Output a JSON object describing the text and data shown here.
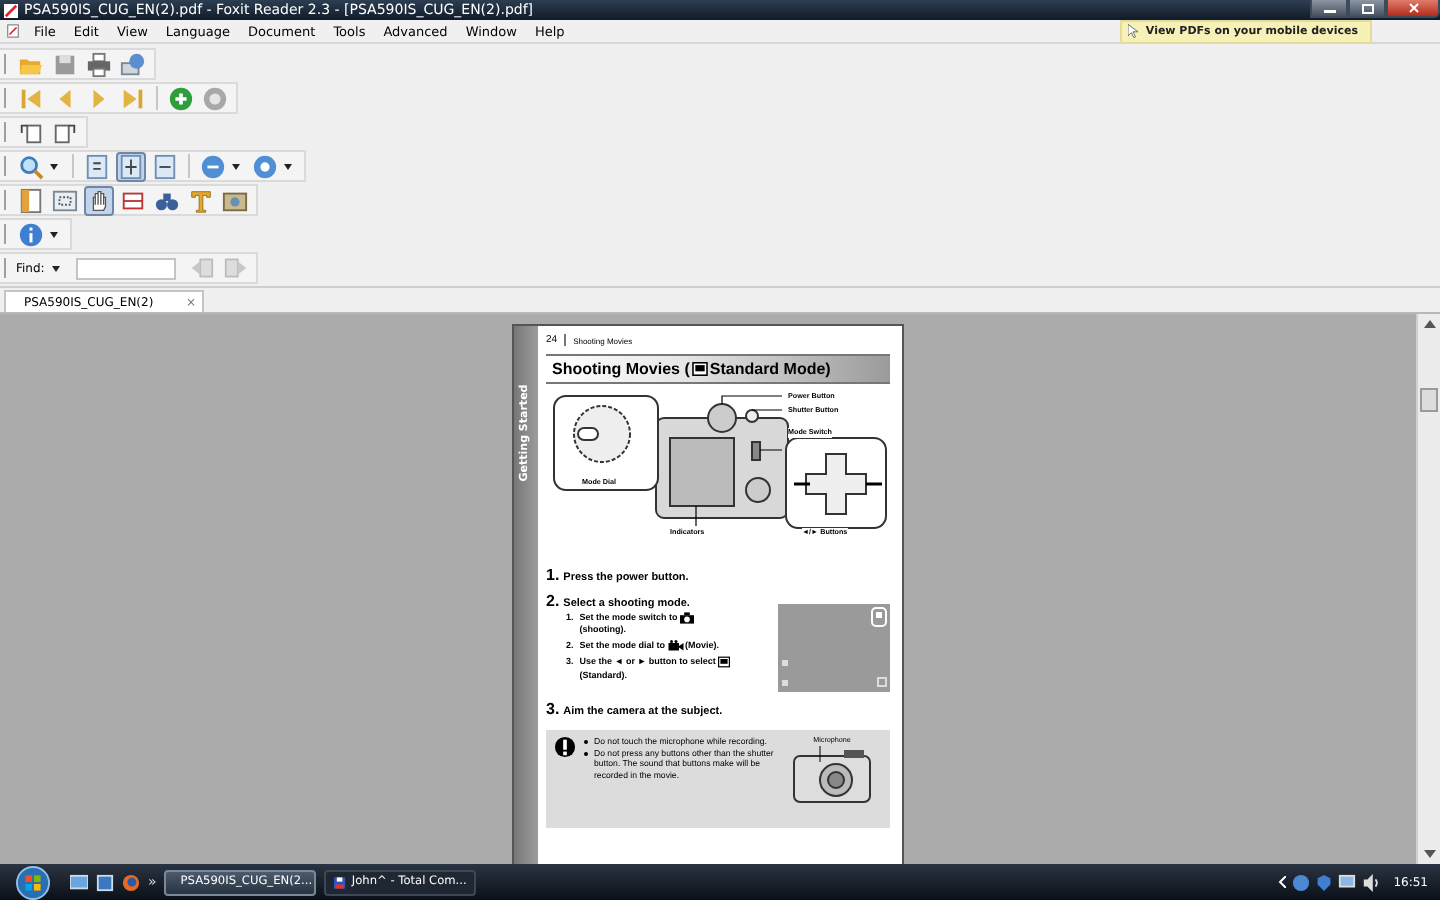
{
  "window": {
    "title": "PSA590IS_CUG_EN(2).pdf - Foxit Reader 2.3 - [PSA590IS_CUG_EN(2).pdf]"
  },
  "menu": [
    "File",
    "Edit",
    "View",
    "Language",
    "Document",
    "Tools",
    "Advanced",
    "Window",
    "Help"
  ],
  "promo": "View PDFs on your mobile devices",
  "toolbars": [
    {
      "tools": [
        {
          "kind": "open",
          "selected": false
        },
        {
          "kind": "save",
          "selected": false
        },
        {
          "kind": "print",
          "selected": false
        },
        {
          "kind": "globe",
          "selected": false
        }
      ]
    },
    {
      "tools": [
        {
          "kind": "first",
          "selected": false
        },
        {
          "kind": "prev",
          "selected": false
        },
        {
          "kind": "next",
          "selected": false
        },
        {
          "kind": "last",
          "selected": false
        },
        {
          "kind": "sep"
        },
        {
          "kind": "forward",
          "selected": false
        },
        {
          "kind": "back",
          "selected": false
        }
      ]
    },
    {
      "tools": [
        {
          "kind": "rotate-left",
          "selected": false
        },
        {
          "kind": "rotate-right",
          "selected": false
        }
      ]
    },
    {
      "tools": [
        {
          "kind": "zoom",
          "selected": false,
          "dropdown": true
        },
        {
          "kind": "sep"
        },
        {
          "kind": "actual",
          "selected": false
        },
        {
          "kind": "fit-page",
          "selected": true
        },
        {
          "kind": "fit-width",
          "selected": false
        },
        {
          "kind": "sep"
        },
        {
          "kind": "zoom-out",
          "selected": false,
          "dropdown": true
        },
        {
          "kind": "zoom-in",
          "selected": false,
          "dropdown": true
        }
      ]
    },
    {
      "tools": [
        {
          "kind": "page",
          "selected": false
        },
        {
          "kind": "snapshot",
          "selected": false
        },
        {
          "kind": "hand",
          "selected": true
        },
        {
          "kind": "select",
          "selected": false
        },
        {
          "kind": "binoculars",
          "selected": false
        },
        {
          "kind": "typewriter",
          "selected": false
        },
        {
          "kind": "image",
          "selected": false
        }
      ]
    },
    {
      "tools": [
        {
          "kind": "info",
          "selected": false,
          "dropdown": true
        }
      ]
    }
  ],
  "find": {
    "label": "Find:"
  },
  "tabs": [
    {
      "label": "PSA590IS_CUG_EN(2)",
      "selected": true,
      "close": "×"
    }
  ],
  "page": {
    "number": "24",
    "running_head": "Shooting Movies",
    "side_tab": "Getting Started",
    "heading": {
      "before": "Shooting Movies (",
      "after": "Standard Mode)"
    },
    "callouts": [
      {
        "kind": "power",
        "text": "Power Button"
      },
      {
        "kind": "shutter",
        "text": "Shutter Button"
      },
      {
        "kind": "switch",
        "text": "Mode Switch"
      },
      {
        "kind": "dial",
        "text": "Mode Dial"
      },
      {
        "kind": "indicators",
        "text": "Indicators"
      },
      {
        "kind": "buttons",
        "text": "◄/► Buttons"
      }
    ],
    "steps": [
      {
        "number": "1.",
        "text": "Press the power button."
      },
      {
        "number": "2.",
        "text": "Select a shooting mode.",
        "substeps": [
          {
            "number": "1.",
            "before": "Set the mode switch to",
            "kind": "camera",
            "after": "(shooting)."
          },
          {
            "number": "2.",
            "before": "Set the mode dial to",
            "kind": "movie",
            "after": "(Movie)."
          },
          {
            "number": "3.",
            "before": "Use the ◄ or ► button to select",
            "kind": "standard",
            "after": "(Standard)."
          }
        ]
      },
      {
        "number": "3.",
        "text": "Aim the camera at the subject."
      }
    ],
    "notes": [
      "Do not touch the microphone while recording.",
      "Do not press any buttons other than the shutter button. The sound that buttons make will be recorded in the movie."
    ],
    "microphone_label": "Microphone"
  },
  "taskbar": {
    "more": "»",
    "buttons": [
      {
        "label": "PSA590IS_CUG_EN(2...",
        "kind": "pdf",
        "selected": true
      },
      {
        "label": "John^ - Total Com...",
        "kind": "disk",
        "selected": false
      }
    ],
    "clock": "16:51"
  }
}
